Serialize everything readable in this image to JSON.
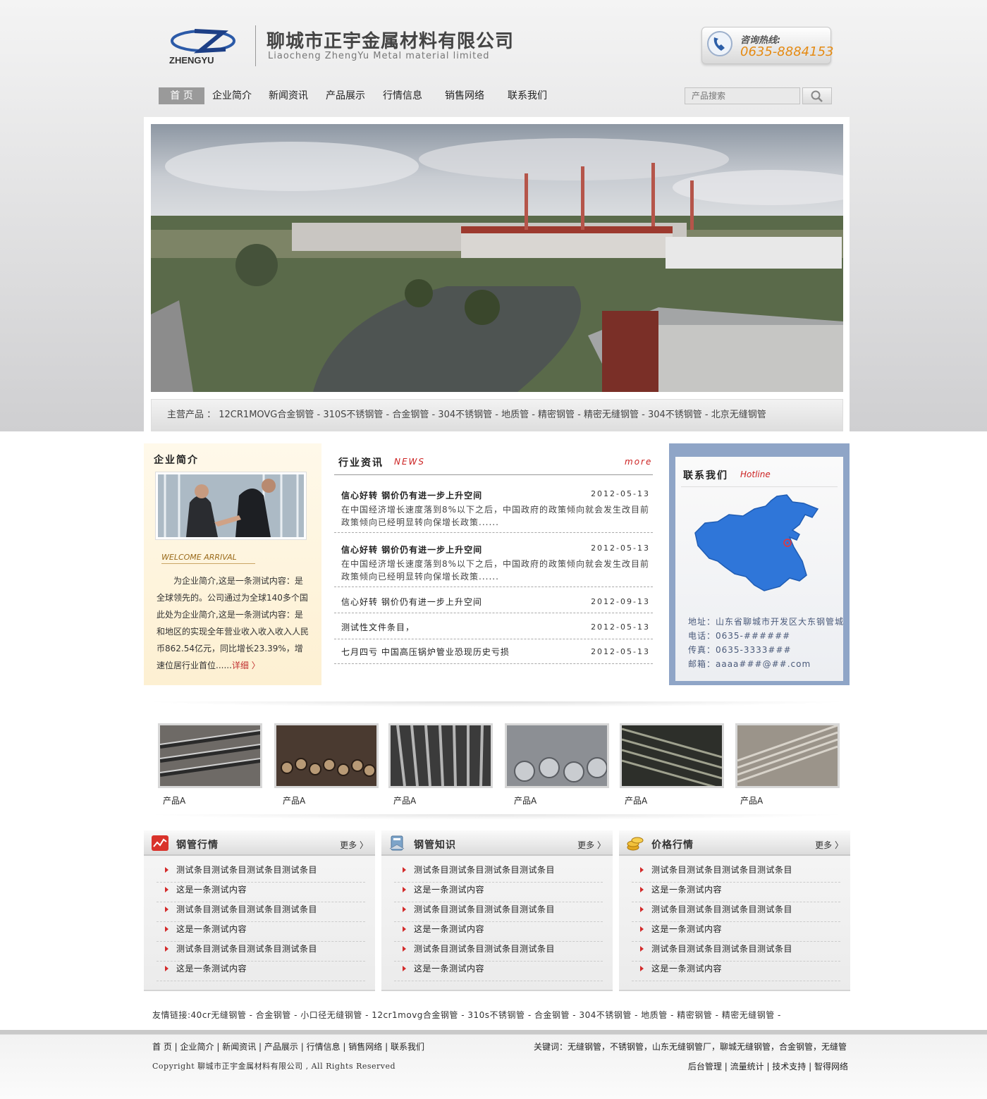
{
  "header": {
    "company_cn": "聊城市正宇金属材料有限公司",
    "company_en": "Liaocheng ZhengYu Metal material limited",
    "logo_text": "ZHENGYU",
    "hotline_label": "咨询热线:",
    "hotline_number": "0635-8884153"
  },
  "nav": {
    "items": [
      "首 页",
      "企业简介",
      "新闻资讯",
      "产品展示",
      "行情信息",
      "销售网络",
      "联系我们"
    ],
    "active_index": 0,
    "search_placeholder": "产品搜索"
  },
  "banner": {
    "main_products": "主营产品 ： 12CR1MOVG合金钢管 - 310S不锈钢管 - 合金钢管 - 304不锈钢管 - 地质管 - 精密钢管 - 精密无缝钢管 - 304不锈钢管 - 北京无缝钢管"
  },
  "about": {
    "title": "企业简介",
    "welcome": "WELCOME ARRIVAL",
    "text": "为企业简介,这是一条测试内容：是全球领先的。公司通过为全球140多个国此处为企业简介,这是一条测试内容：是和地区的实现全年营业收入收入收入人民币862.54亿元，同比增长23.39%，增速位居行业首位......",
    "more": "详细 〉"
  },
  "news": {
    "title": "行业资讯",
    "title_en": "NEWS",
    "more": "more",
    "items": [
      {
        "title": "信心好转 钢价仍有进一步上升空间",
        "date": "2012-05-13",
        "summary": "在中国经济增长速度落到8%以下之后，中国政府的政策倾向就会发生改目前政策倾向已经明显转向保增长政策......"
      },
      {
        "title": "信心好转 钢价仍有进一步上升空间",
        "date": "2012-05-13",
        "summary": "在中国经济增长速度落到8%以下之后，中国政府的政策倾向就会发生改目前政策倾向已经明显转向保增长政策......"
      },
      {
        "title": "信心好转 钢价仍有进一步上升空间",
        "date": "2012-09-13"
      },
      {
        "title": "测试性文件条目，",
        "date": "2012-05-13"
      },
      {
        "title": "七月四亏 中国高压锅炉管业恐现历史亏损",
        "date": "2012-05-13"
      }
    ]
  },
  "contact": {
    "title": "联系我们",
    "title_en": "Hotline",
    "address": "地址：山东省聊城市开发区大东钢管城",
    "phone": "电话：0635-######",
    "fax": "传真：0635-3333###",
    "email": "邮箱：aaaa###@##.com"
  },
  "products": [
    {
      "name": "产品A"
    },
    {
      "name": "产品A"
    },
    {
      "name": "产品A"
    },
    {
      "name": "产品A"
    },
    {
      "name": "产品A"
    },
    {
      "name": "产品A"
    }
  ],
  "columns": [
    {
      "title": "钢管行情",
      "more": "更多 〉",
      "items": [
        "测试条目测试条目测试条目测试条目",
        "这是一条测试内容",
        "测试条目测试条目测试条目测试条目",
        "这是一条测试内容",
        "测试条目测试条目测试条目测试条目",
        "这是一条测试内容"
      ]
    },
    {
      "title": "钢管知识",
      "more": "更多 〉",
      "items": [
        "测试条目测试条目测试条目测试条目",
        "这是一条测试内容",
        "测试条目测试条目测试条目测试条目",
        "这是一条测试内容",
        "测试条目测试条目测试条目测试条目",
        "这是一条测试内容"
      ]
    },
    {
      "title": "价格行情",
      "more": "更多 〉",
      "items": [
        "测试条目测试条目测试条目测试条目",
        "这是一条测试内容",
        "测试条目测试条目测试条目测试条目",
        "这是一条测试内容",
        "测试条目测试条目测试条目测试条目",
        "这是一条测试内容"
      ]
    }
  ],
  "friend_links": "友情链接:40cr无缝钢管 - 合金钢管 - 小口径无缝钢管 - 12cr1movg合金钢管 - 310s不锈钢管 - 合金钢管 - 304不锈钢管 - 地质管 - 精密钢管 - 精密无缝钢管 -",
  "footer": {
    "nav": [
      "首 页",
      "企业简介",
      "新闻资讯",
      "产品展示",
      "行情信息",
      "销售网络",
      "联系我们"
    ],
    "copyright": "Copyright 聊城市正宇金属材料有限公司 , All Rights Reserved",
    "keywords": "关键词：无缝钢管，不锈钢管，山东无缝钢管厂，聊城无缝钢管，合金钢管，无缝管",
    "admin": [
      "后台管理",
      "流量统计",
      "技术支持",
      "智得网络"
    ]
  },
  "colors": {
    "accent_red": "#cc2222",
    "nav_active": "#9a9a9a",
    "contact_blue": "#8fa5c7",
    "map_blue": "#2f76d9",
    "hotline_orange": "#e58a12"
  }
}
